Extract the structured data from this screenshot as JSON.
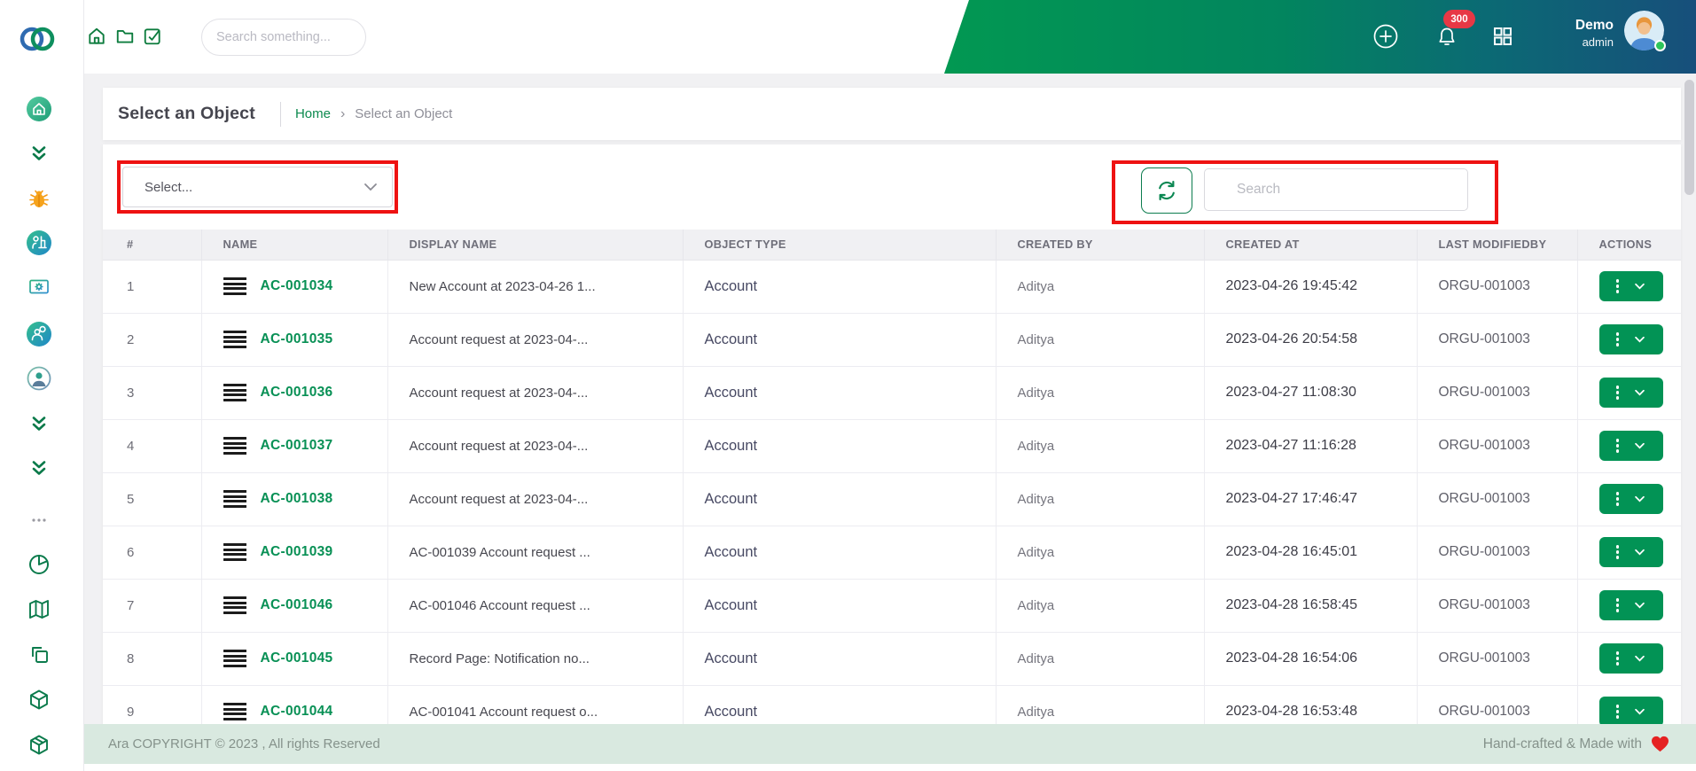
{
  "topbar": {
    "search_placeholder": "Search something...",
    "notification_count": "300",
    "user": {
      "name": "Demo",
      "role": "admin"
    },
    "nav_icons": [
      "home",
      "folder",
      "task-check"
    ],
    "action_icons": [
      "add",
      "notifications",
      "apps-grid"
    ]
  },
  "sidebar": {
    "icons": [
      "home",
      "collapse-double-chevron",
      "bug",
      "service-desk",
      "monitor-settings",
      "user-search",
      "user-profile",
      "double-chevron-down",
      "double-chevron-down",
      "more-options",
      "pie-chart",
      "map",
      "copy",
      "cube",
      "package"
    ]
  },
  "page": {
    "title": "Select an Object",
    "breadcrumb": {
      "home": "Home",
      "separator": "›",
      "current": "Select an Object"
    }
  },
  "filters": {
    "select_placeholder": "Select...",
    "search_placeholder": "Search"
  },
  "table": {
    "headers": [
      "#",
      "NAME",
      "DISPLAY NAME",
      "OBJECT TYPE",
      "CREATED BY",
      "CREATED AT",
      "LAST MODIFIEDBY",
      "ACTIONS"
    ],
    "rows": [
      {
        "num": "1",
        "name": "AC-001034",
        "display_name": "New Account at 2023-04-26 1...",
        "object_type": "Account",
        "created_by": "Aditya",
        "created_at": "2023-04-26 19:45:42",
        "last_modified_by": "ORGU-001003"
      },
      {
        "num": "2",
        "name": "AC-001035",
        "display_name": "Account request at 2023-04-...",
        "object_type": "Account",
        "created_by": "Aditya",
        "created_at": "2023-04-26 20:54:58",
        "last_modified_by": "ORGU-001003"
      },
      {
        "num": "3",
        "name": "AC-001036",
        "display_name": "Account request at 2023-04-...",
        "object_type": "Account",
        "created_by": "Aditya",
        "created_at": "2023-04-27 11:08:30",
        "last_modified_by": "ORGU-001003"
      },
      {
        "num": "4",
        "name": "AC-001037",
        "display_name": "Account request at 2023-04-...",
        "object_type": "Account",
        "created_by": "Aditya",
        "created_at": "2023-04-27 11:16:28",
        "last_modified_by": "ORGU-001003"
      },
      {
        "num": "5",
        "name": "AC-001038",
        "display_name": "Account request at 2023-04-...",
        "object_type": "Account",
        "created_by": "Aditya",
        "created_at": "2023-04-27 17:46:47",
        "last_modified_by": "ORGU-001003"
      },
      {
        "num": "6",
        "name": "AC-001039",
        "display_name": "AC-001039 Account request ...",
        "object_type": "Account",
        "created_by": "Aditya",
        "created_at": "2023-04-28 16:45:01",
        "last_modified_by": "ORGU-001003"
      },
      {
        "num": "7",
        "name": "AC-001046",
        "display_name": "AC-001046 Account request ...",
        "object_type": "Account",
        "created_by": "Aditya",
        "created_at": "2023-04-28 16:58:45",
        "last_modified_by": "ORGU-001003"
      },
      {
        "num": "8",
        "name": "AC-001045",
        "display_name": "Record Page: Notification no...",
        "object_type": "Account",
        "created_by": "Aditya",
        "created_at": "2023-04-28 16:54:06",
        "last_modified_by": "ORGU-001003"
      },
      {
        "num": "9",
        "name": "AC-001044",
        "display_name": "AC-001041 Account request o...",
        "object_type": "Account",
        "created_by": "Aditya",
        "created_at": "2023-04-28 16:53:48",
        "last_modified_by": "ORGU-001003"
      }
    ]
  },
  "footer": {
    "copyright": "Ara COPYRIGHT © 2023 , All rights Reserved",
    "credit": "Hand-crafted & Made with"
  },
  "colors": {
    "accent_green": "#029150",
    "actions_button": "#029355",
    "annotation_red": "#ee1212",
    "badge_red": "#e73845",
    "header_gradient_start": "#029852",
    "header_gradient_end": "#174f7b",
    "footer_bg": "#d9e9e0"
  }
}
